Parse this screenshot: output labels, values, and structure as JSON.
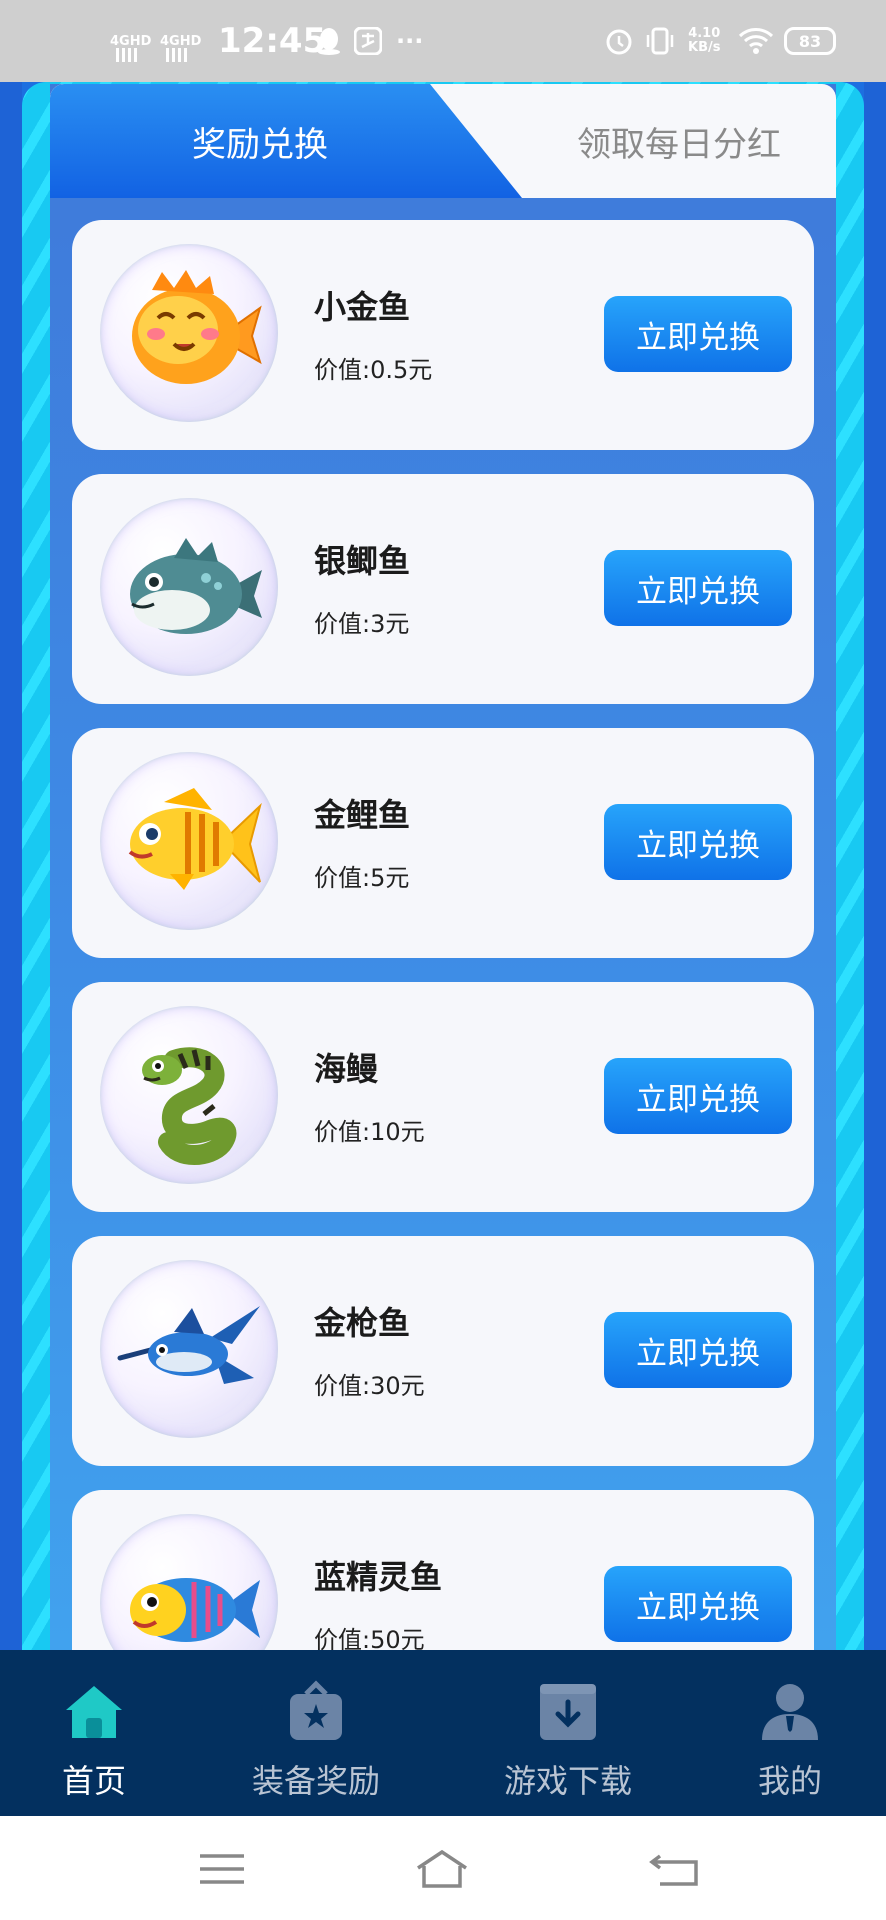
{
  "status_bar": {
    "signal1": "4GHD",
    "signal2": "4GHD",
    "time": "12:45",
    "more": "···",
    "speed_value": "4.10",
    "speed_unit": "KB/s",
    "battery": "83"
  },
  "tabs": [
    {
      "label": "奖励兑换",
      "active": true
    },
    {
      "label": "领取每日分红",
      "active": false
    }
  ],
  "rewards": [
    {
      "name": "小金鱼",
      "value": "价值:0.5元",
      "button": "立即兑换",
      "icon": "orange-pufferfish"
    },
    {
      "name": "银鲫鱼",
      "value": "价值:3元",
      "button": "立即兑换",
      "icon": "teal-pufferfish"
    },
    {
      "name": "金鲤鱼",
      "value": "价值:5元",
      "button": "立即兑换",
      "icon": "yellow-striped-fish"
    },
    {
      "name": "海鳗",
      "value": "价值:10元",
      "button": "立即兑换",
      "icon": "green-eel"
    },
    {
      "name": "金枪鱼",
      "value": "价值:30元",
      "button": "立即兑换",
      "icon": "blue-swordfish"
    },
    {
      "name": "蓝精灵鱼",
      "value": "价值:50元",
      "button": "立即兑换",
      "icon": "blue-yellow-fish"
    }
  ],
  "bottom_nav": [
    {
      "label": "首页",
      "icon": "home-icon",
      "active": true
    },
    {
      "label": "装备奖励",
      "icon": "gift-star-icon",
      "active": false
    },
    {
      "label": "游戏下载",
      "icon": "download-box-icon",
      "active": false
    },
    {
      "label": "我的",
      "icon": "user-icon",
      "active": false
    }
  ],
  "colors": {
    "accent": "#1a7ef0",
    "nav_bg": "#03305f",
    "card_bg": "#f6f7fb"
  }
}
